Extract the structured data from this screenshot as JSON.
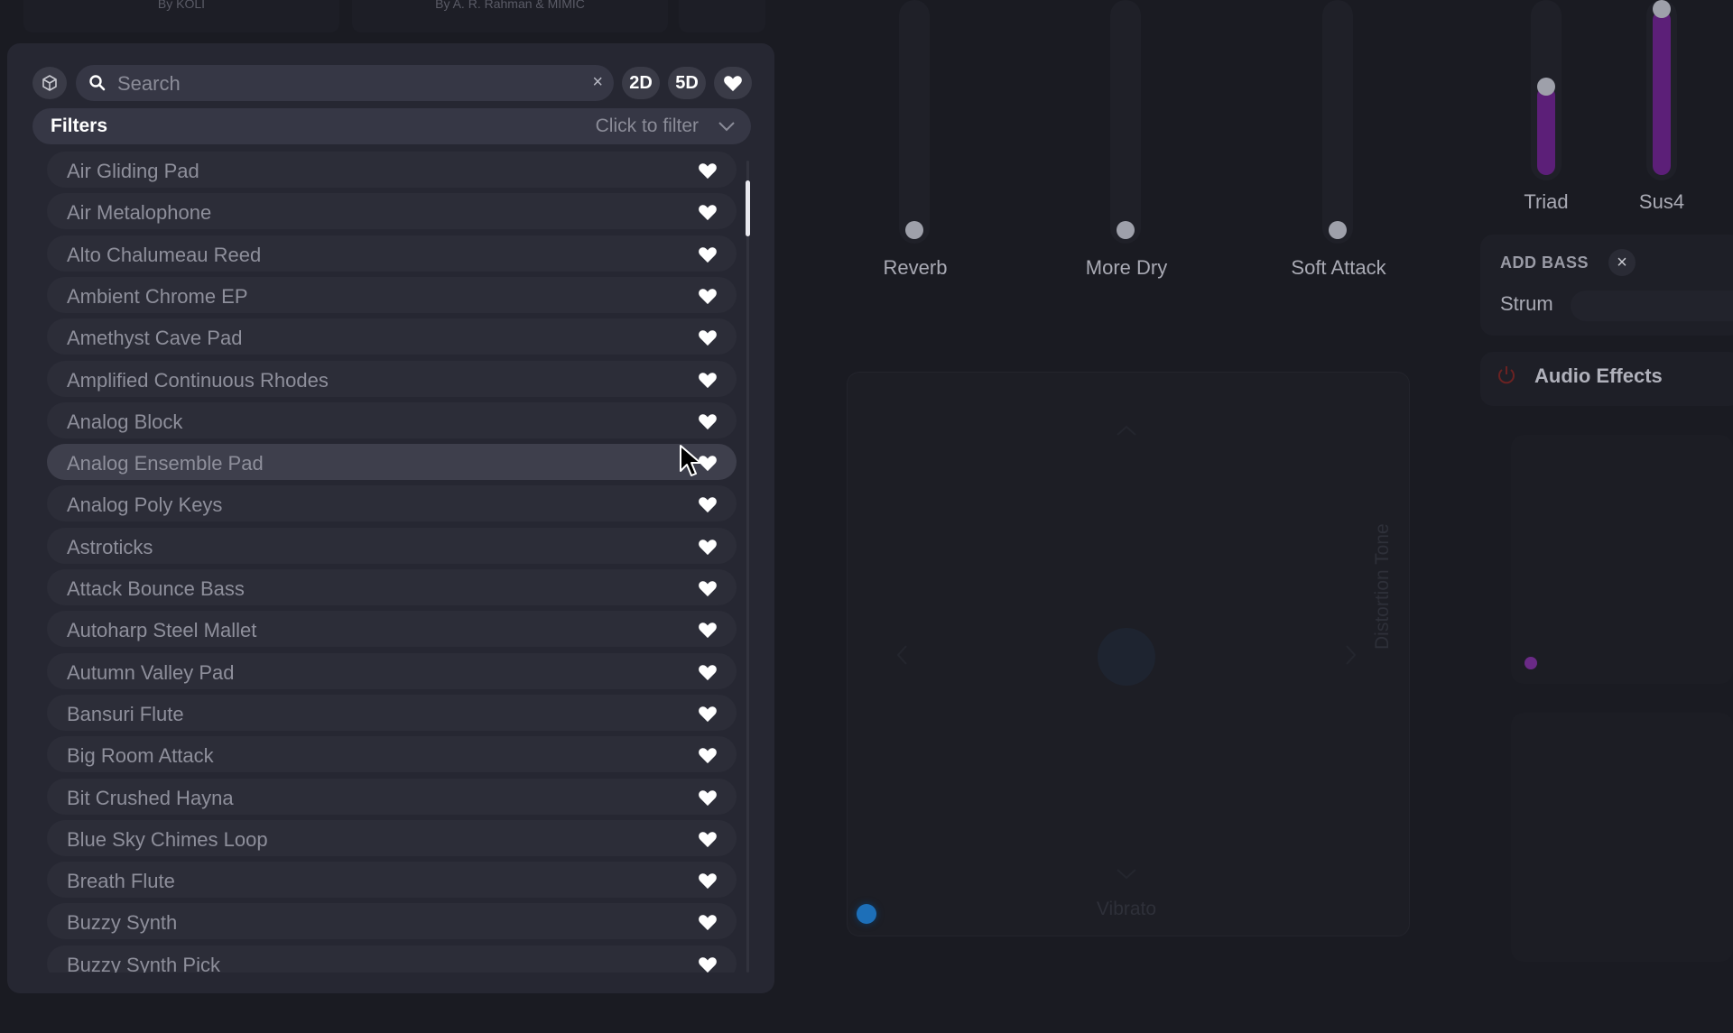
{
  "top_cards": [
    {
      "label": "By KOLI"
    },
    {
      "label": "By A. R. Rahman & MIMIC"
    },
    {
      "label": ""
    }
  ],
  "browser": {
    "search": {
      "placeholder": "Search",
      "value": ""
    },
    "clear_label": "×",
    "mode_2d": "2D",
    "mode_5d": "5D",
    "filters_label": "Filters",
    "filters_hint": "Click to filter",
    "presets": [
      {
        "name": "Air Gliding Pad",
        "selected": false
      },
      {
        "name": "Air Metalophone",
        "selected": false
      },
      {
        "name": "Alto Chalumeau Reed",
        "selected": false
      },
      {
        "name": "Ambient Chrome EP",
        "selected": false
      },
      {
        "name": "Amethyst Cave Pad",
        "selected": false
      },
      {
        "name": "Amplified Continuous Rhodes",
        "selected": false
      },
      {
        "name": "Analog Block",
        "selected": false
      },
      {
        "name": "Analog Ensemble Pad",
        "selected": true
      },
      {
        "name": "Analog Poly Keys",
        "selected": false
      },
      {
        "name": "Astroticks",
        "selected": false
      },
      {
        "name": "Attack Bounce Bass",
        "selected": false
      },
      {
        "name": "Autoharp Steel Mallet",
        "selected": false
      },
      {
        "name": "Autumn Valley Pad",
        "selected": false
      },
      {
        "name": "Bansuri Flute",
        "selected": false
      },
      {
        "name": "Big Room Attack",
        "selected": false
      },
      {
        "name": "Bit Crushed Hayna",
        "selected": false
      },
      {
        "name": "Blue Sky Chimes Loop",
        "selected": false
      },
      {
        "name": "Breath Flute",
        "selected": false
      },
      {
        "name": "Buzzy Synth",
        "selected": false
      },
      {
        "name": "Buzzy Synth Pick",
        "selected": false
      }
    ]
  },
  "macros": {
    "reverb": "Reverb",
    "more_dry": "More Dry",
    "soft_attack": "Soft Attack",
    "triad": "Triad",
    "sus4": "Sus4"
  },
  "xy_pad": {
    "y_label": "Distortion Tone",
    "x_label": "Vibrato"
  },
  "chords": {
    "add_bass": "ADD BASS",
    "add_bass_close": "×",
    "strum": "Strum"
  },
  "effects": {
    "title": "Audio Effects"
  },
  "colors": {
    "accent_blue": "#1d6fb8",
    "accent_purple": "#5c1f78",
    "panel": "#262732"
  }
}
